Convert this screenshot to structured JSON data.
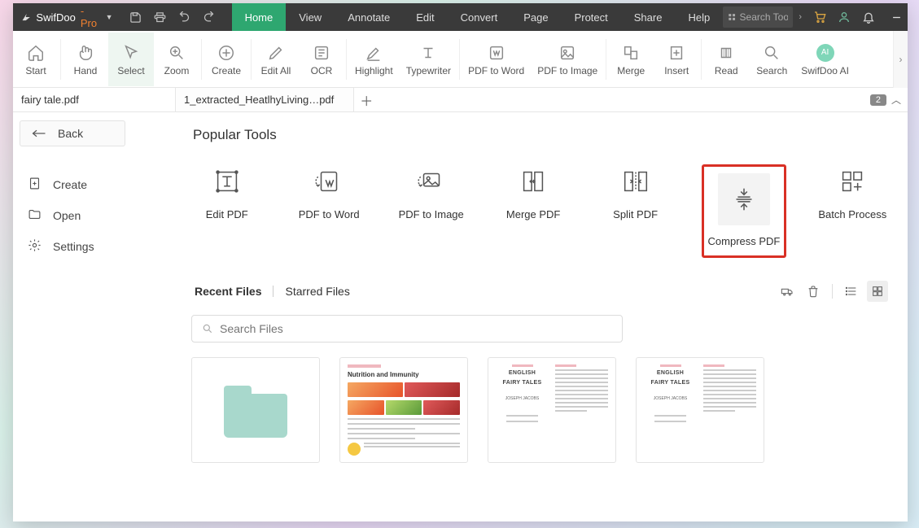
{
  "brand": {
    "name": "SwifDoo",
    "suffix": "-Pro"
  },
  "menus": [
    "Home",
    "View",
    "Annotate",
    "Edit",
    "Convert",
    "Page",
    "Protect",
    "Share",
    "Help"
  ],
  "activeMenuIndex": 0,
  "searchTools": {
    "placeholder": "Search Tools"
  },
  "ribbon": [
    {
      "label": "Start"
    },
    {
      "label": "Hand"
    },
    {
      "label": "Select"
    },
    {
      "label": "Zoom"
    },
    {
      "label": "Create"
    },
    {
      "label": "Edit All"
    },
    {
      "label": "OCR"
    },
    {
      "label": "Highlight"
    },
    {
      "label": "Typewriter"
    },
    {
      "label": "PDF to Word"
    },
    {
      "label": "PDF to Image"
    },
    {
      "label": "Merge"
    },
    {
      "label": "Insert"
    },
    {
      "label": "Read"
    },
    {
      "label": "Search"
    },
    {
      "label": "SwifDoo AI"
    }
  ],
  "tabs": [
    "fairy tale.pdf",
    "1_extracted_HeatlhyLiving…pdf"
  ],
  "tabCount": "2",
  "back": "Back",
  "side": {
    "create": "Create",
    "open": "Open",
    "settings": "Settings"
  },
  "sectionTitle": "Popular Tools",
  "tools": {
    "edit": "Edit PDF",
    "toword": "PDF to Word",
    "toimage": "PDF to Image",
    "merge": "Merge PDF",
    "split": "Split PDF",
    "compress": "Compress PDF",
    "batch": "Batch Process"
  },
  "recent": {
    "files": "Recent Files",
    "starred": "Starred Files"
  },
  "searchFiles": {
    "placeholder": "Search Files"
  },
  "thumbs": {
    "nutrition": "Nutrition and Immunity",
    "ft_h1": "ENGLISH",
    "ft_h2": "FAIRY TALES",
    "ft_auth": "JOSEPH JACOBS"
  }
}
